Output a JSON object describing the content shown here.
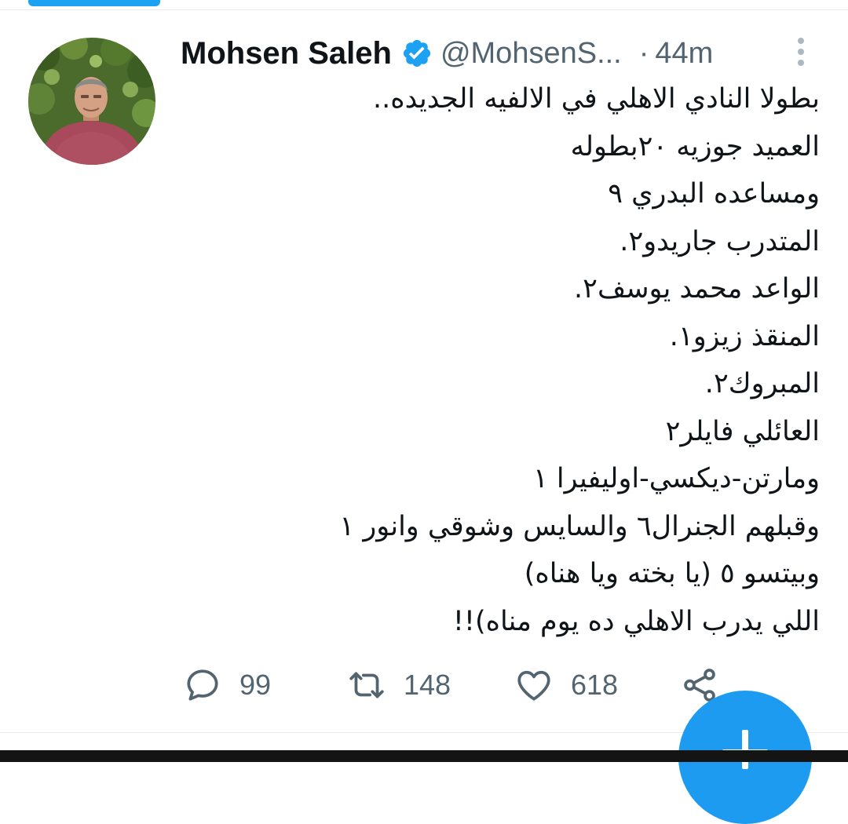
{
  "tweet": {
    "author": {
      "display_name": "Mohsen Saleh",
      "handle": "@MohsenS...",
      "verified": true,
      "avatar_icon": "profile-photo"
    },
    "separator": "·",
    "timestamp": "44m",
    "lines": [
      "بطولا النادي الاهلي في الالفيه الجديده..",
      "العميد جوزيه ٢٠بطوله",
      "ومساعده البدري ٩",
      "المتدرب جاريدو٢.",
      "الواعد محمد يوسف٢.",
      "المنقذ زيزو١.",
      "المبروك٢.",
      "العائلي فايلر٢",
      "ومارتن-ديكسي-اوليفيرا ١",
      "وقبلهم الجنرال٦ والسايس وشوقي وانور ١",
      "وبيتسو ٥ (يا بخته ويا هناه)",
      "اللي يدرب الاهلي ده يوم مناه)!!"
    ],
    "actions": {
      "reply": {
        "icon": "reply-icon",
        "count": "99"
      },
      "retweet": {
        "icon": "retweet-icon",
        "count": "148"
      },
      "like": {
        "icon": "heart-icon",
        "count": "618"
      },
      "share": {
        "icon": "share-icon"
      }
    }
  },
  "compose_button": {
    "icon": "plus-icon"
  },
  "colors": {
    "accent": "#1da1f2",
    "text_primary": "#0f1419",
    "text_secondary": "#536471"
  }
}
